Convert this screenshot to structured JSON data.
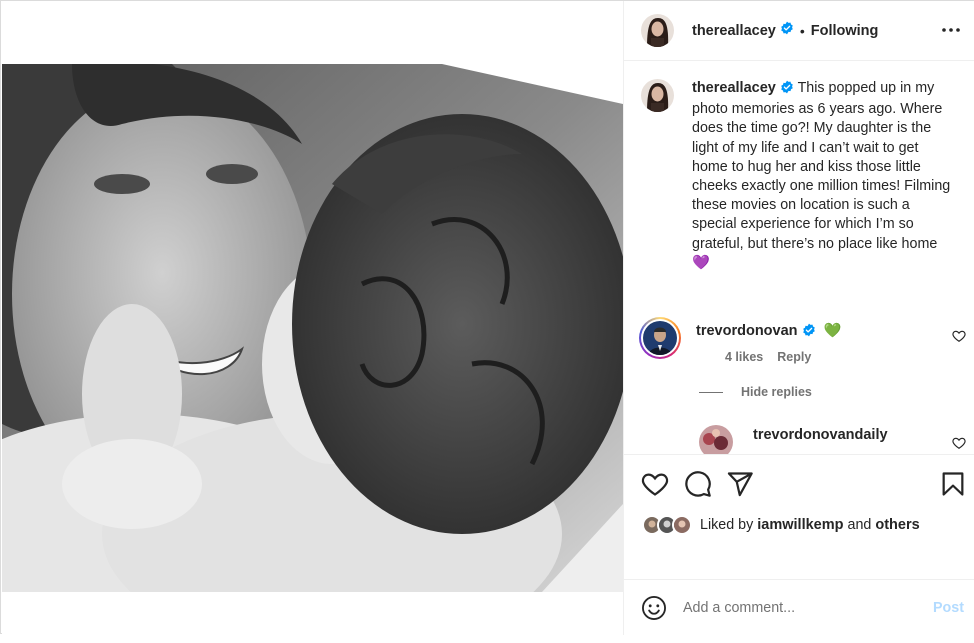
{
  "header": {
    "username": "thereallacey",
    "separator": "•",
    "follow_status": "Following",
    "more_icon": "more-horizontal-icon"
  },
  "caption": {
    "username": "thereallacey",
    "text": "This popped up in my photo memories as 6 years ago. Where does the time go?! My daughter is the light of my life and I can’t wait to get home to hug her and kiss those little cheeks exactly one million times! Filming these movies on location is such a special experience for which I’m so grateful, but there’s no place like home 💜"
  },
  "comments": [
    {
      "username": "trevordonovan",
      "text": "💚",
      "likes": "4 likes",
      "reply_label": "Reply"
    }
  ],
  "replies": {
    "toggle_label": "Hide replies",
    "items": [
      {
        "username": "trevordonovandaily"
      }
    ]
  },
  "actions": {
    "like_icon": "heart-icon",
    "comment_icon": "comment-icon",
    "share_icon": "send-icon",
    "save_icon": "bookmark-icon"
  },
  "likes": {
    "prefix": "Liked by",
    "user": "iamwillkemp",
    "joiner": "and",
    "others": "others"
  },
  "add_comment": {
    "placeholder": "Add a comment...",
    "post_label": "Post"
  },
  "colors": {
    "verified": "#0095f6",
    "post_disabled": "#b3dbff",
    "secondary_text": "#737373"
  }
}
